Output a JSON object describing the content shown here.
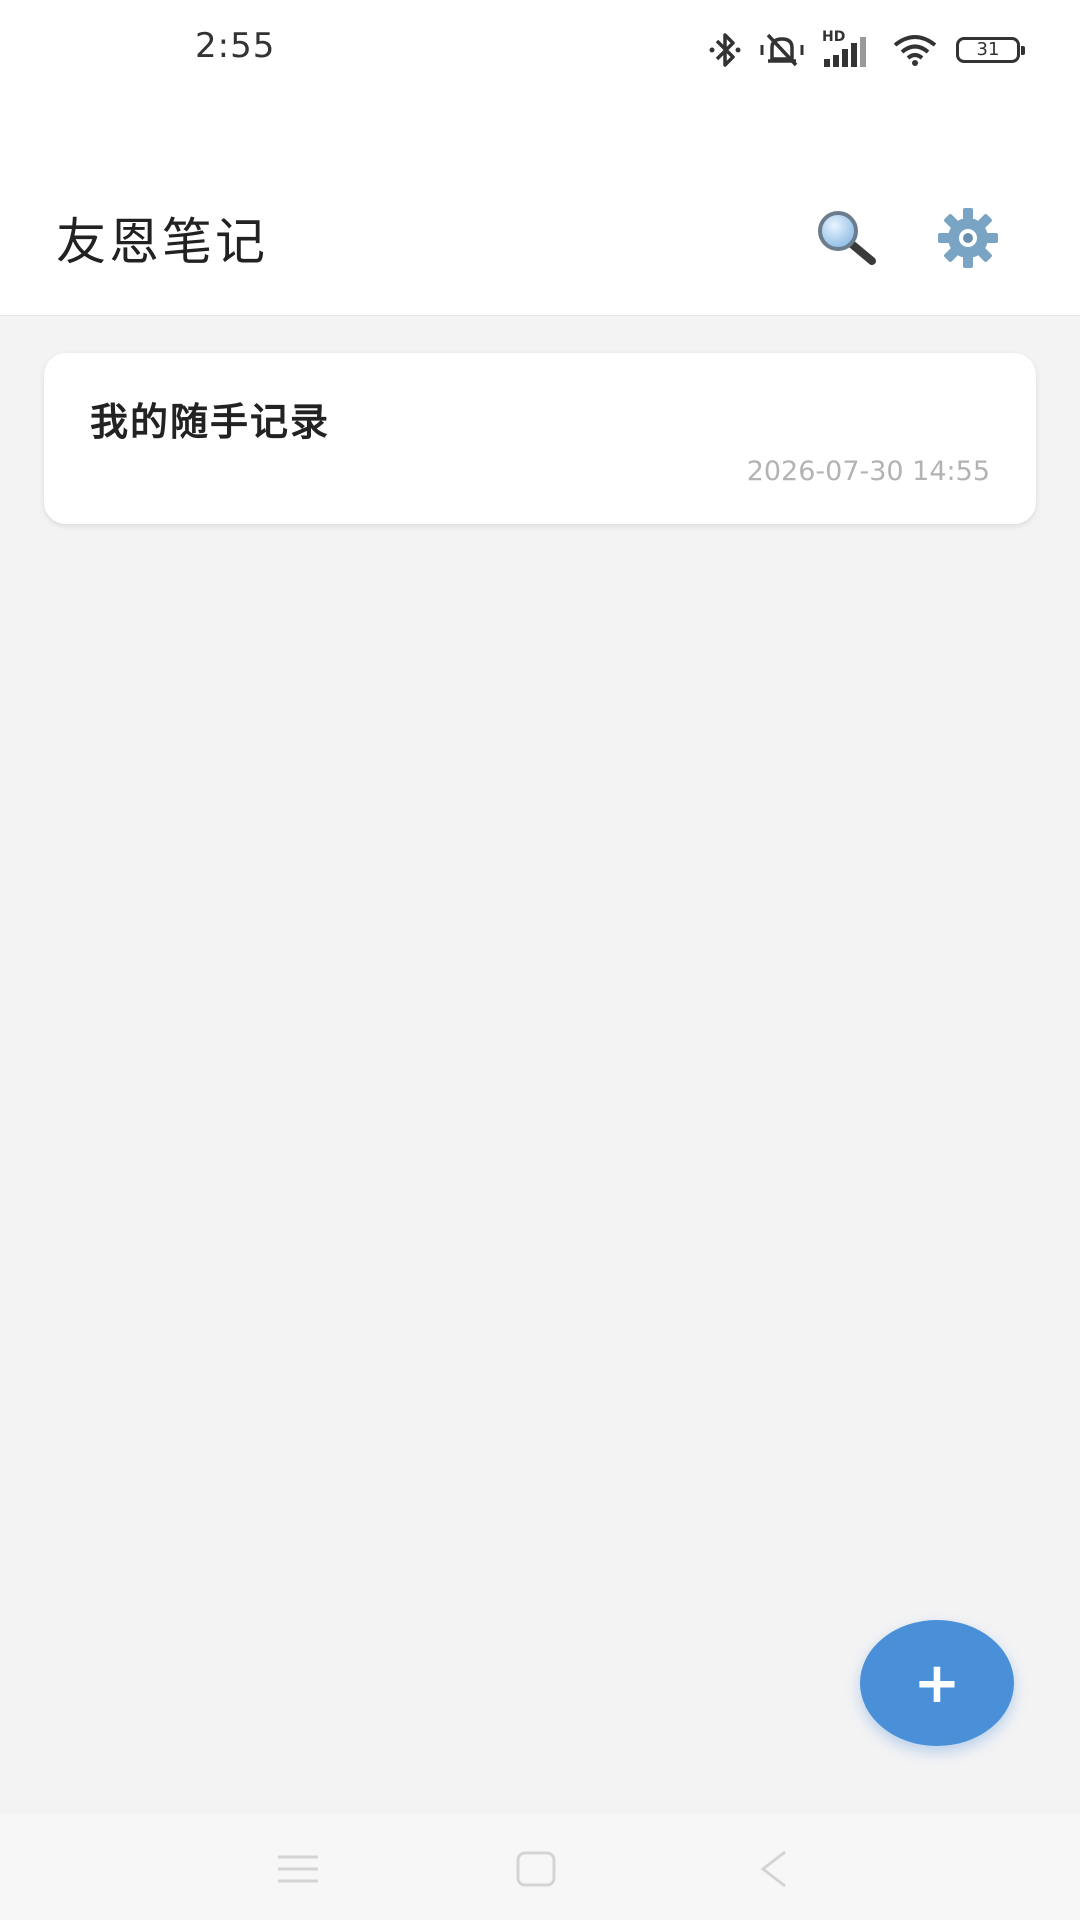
{
  "status_bar": {
    "time": "2:55",
    "network_label": "HD",
    "battery_level": "31"
  },
  "header": {
    "title": "友恩笔记",
    "icons": {
      "search": "search-icon",
      "settings": "gear-icon"
    }
  },
  "notes": [
    {
      "title": "我的随手记录",
      "timestamp": "2026-07-30 14:55"
    }
  ],
  "fab": {
    "label": "+"
  },
  "nav_bar": {
    "icons": [
      "menu-icon",
      "home-icon",
      "back-icon"
    ]
  },
  "colors": {
    "accent": "#4a90d9",
    "background": "#f3f3f4",
    "card": "#ffffff",
    "timestamp": "#b3b3b3"
  }
}
